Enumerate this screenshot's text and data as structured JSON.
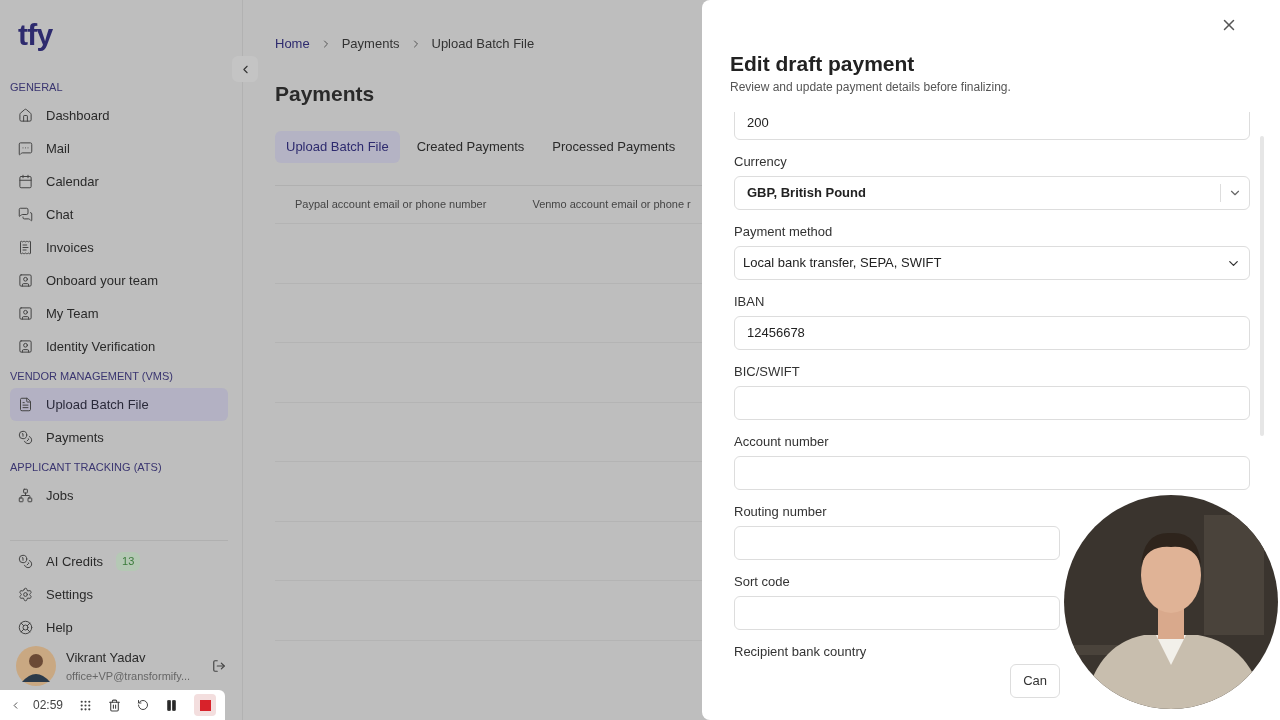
{
  "sidebar": {
    "logo": "tfy",
    "sections": [
      {
        "title": "GENERAL",
        "items": [
          {
            "label": "Dashboard",
            "selected": false
          },
          {
            "label": "Mail",
            "selected": false
          },
          {
            "label": "Calendar",
            "selected": false
          },
          {
            "label": "Chat",
            "selected": false
          },
          {
            "label": "Invoices",
            "selected": false
          },
          {
            "label": "Onboard your team",
            "selected": false
          },
          {
            "label": "My Team",
            "selected": false
          },
          {
            "label": "Identity Verification",
            "selected": false
          }
        ]
      },
      {
        "title": "VENDOR MANAGEMENT (VMS)",
        "items": [
          {
            "label": "Upload Batch File",
            "selected": true
          },
          {
            "label": "Payments",
            "selected": false
          }
        ]
      },
      {
        "title": "APPLICANT TRACKING (ATS)",
        "items": [
          {
            "label": "Jobs",
            "selected": false
          }
        ]
      }
    ],
    "bottom_items": [
      {
        "label": "AI Credits",
        "badge": "13"
      },
      {
        "label": "Settings"
      },
      {
        "label": "Help"
      }
    ],
    "user": {
      "name": "Vikrant Yadav",
      "email": "office+VP@transformify..."
    }
  },
  "recorder": {
    "time": "02:59"
  },
  "breadcrumb": [
    "Home",
    "Payments",
    "Upload Batch File"
  ],
  "page_title": "Payments",
  "tabs": [
    {
      "label": "Upload Batch File",
      "selected": true
    },
    {
      "label": "Created Payments",
      "selected": false
    },
    {
      "label": "Processed Payments",
      "selected": false
    }
  ],
  "table": {
    "columns": [
      "Paypal account email or phone number",
      "Venmo account email or phone r"
    ]
  },
  "drawer": {
    "title": "Edit draft payment",
    "subtitle": "Review and update payment details before finalizing.",
    "fields": [
      {
        "kind": "input",
        "value": "200"
      },
      {
        "kind": "combobox",
        "label": "Currency",
        "value": "GBP, British Pound"
      },
      {
        "kind": "select",
        "label": "Payment method",
        "value": "Local bank transfer, SEPA, SWIFT"
      },
      {
        "kind": "input",
        "label": "IBAN",
        "value": "12456678"
      },
      {
        "kind": "input",
        "label": "BIC/SWIFT"
      },
      {
        "kind": "input",
        "label": "Account number"
      },
      {
        "kind": "input",
        "label": "Routing number"
      },
      {
        "kind": "input",
        "label": "Sort code"
      },
      {
        "kind": "input",
        "label": "Recipient bank country"
      }
    ],
    "cancel": "Can"
  }
}
